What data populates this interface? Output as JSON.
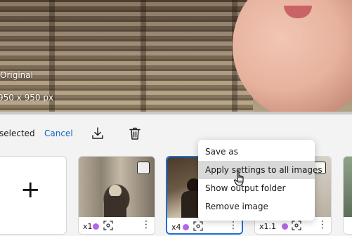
{
  "preview": {
    "label": "Original",
    "dimensions": "950 x 950 px"
  },
  "toolbar": {
    "selected_text": "selected",
    "cancel_label": "Cancel",
    "download_icon": "download-icon",
    "delete_icon": "trash-icon"
  },
  "add_tile": {
    "icon": "plus-icon",
    "glyph": "+"
  },
  "thumbnails": [
    {
      "scale": "x1",
      "selected": false,
      "dot_color": "#b565e8"
    },
    {
      "scale": "x4",
      "selected": true,
      "dot_color": "#b565e8"
    },
    {
      "scale": "x1.1",
      "selected": false,
      "dot_color": "#b565e8"
    },
    {
      "scale": "",
      "selected": false
    }
  ],
  "context_menu": {
    "items": [
      {
        "label": "Save as"
      },
      {
        "label": "Apply settings to all images",
        "hovered": true
      },
      {
        "label": "Show output folder"
      },
      {
        "label": "Remove image"
      }
    ]
  },
  "colors": {
    "accent": "#0a66c2",
    "selection_border": "#1f6fd6",
    "model_dot": "#b565e8",
    "menu_hover": "#d9d9d9"
  }
}
